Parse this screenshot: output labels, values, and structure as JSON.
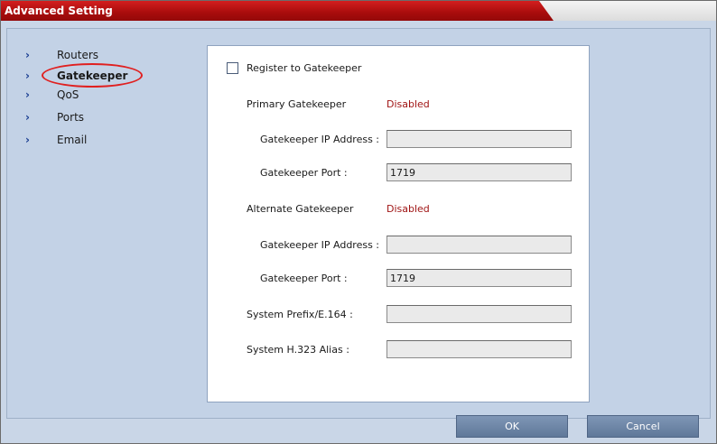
{
  "window": {
    "title": "Advanced Setting"
  },
  "nav": {
    "items": [
      {
        "label": "Routers"
      },
      {
        "label": "Gatekeeper",
        "active": true
      },
      {
        "label": "QoS"
      },
      {
        "label": "Ports"
      },
      {
        "label": "Email"
      }
    ]
  },
  "form": {
    "register_label": "Register to Gatekeeper",
    "register_checked": false,
    "primary": {
      "label": "Primary Gatekeeper",
      "status": "Disabled",
      "ip_label": "Gatekeeper IP Address :",
      "ip_value": "",
      "port_label": "Gatekeeper Port :",
      "port_value": "1719"
    },
    "alternate": {
      "label": "Alternate Gatekeeper",
      "status": "Disabled",
      "ip_label": "Gatekeeper IP Address :",
      "ip_value": "",
      "port_label": "Gatekeeper Port :",
      "port_value": "1719"
    },
    "prefix_label": "System Prefix/E.164 :",
    "prefix_value": "",
    "alias_label": "System H.323 Alias :",
    "alias_value": ""
  },
  "buttons": {
    "ok": "OK",
    "cancel": "Cancel"
  },
  "colors": {
    "title_bar": "#b31212",
    "status_disabled": "#a01515",
    "button": "#6f87a8",
    "highlight_circle": "#e02020"
  }
}
